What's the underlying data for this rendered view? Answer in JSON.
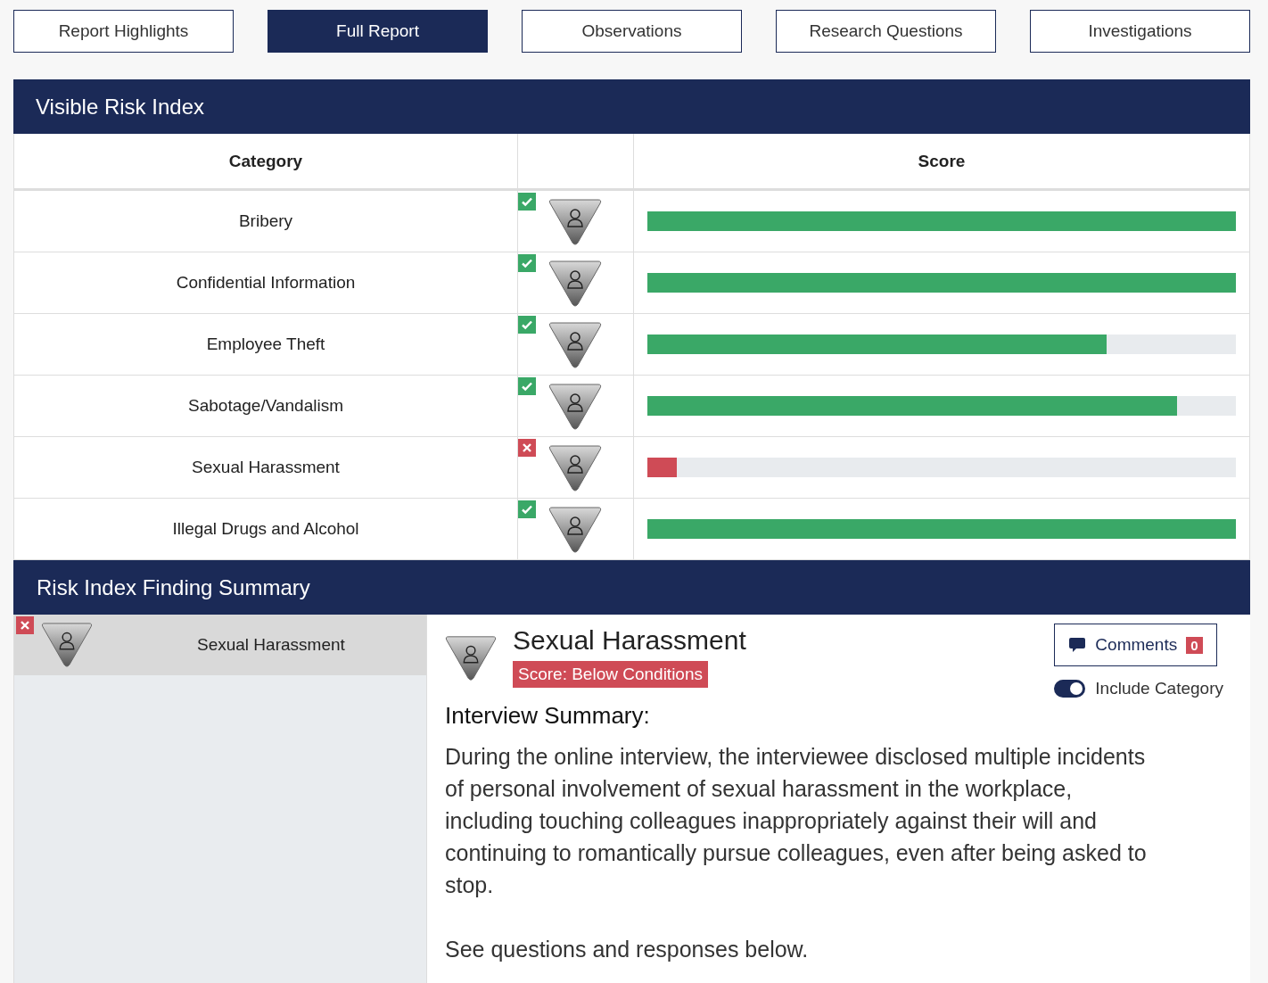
{
  "tabs": [
    {
      "label": "Report Highlights",
      "selected": false
    },
    {
      "label": "Full Report",
      "selected": true
    },
    {
      "label": "Observations",
      "selected": false
    },
    {
      "label": "Research Questions",
      "selected": false
    },
    {
      "label": "Investigations",
      "selected": false
    }
  ],
  "risk_index": {
    "title": "Visible Risk Index",
    "columns": [
      "Category",
      "Score"
    ],
    "rows": [
      {
        "category": "Bribery",
        "included": true,
        "level": 1
      },
      {
        "category": "Confidential Information",
        "included": true,
        "level": 1
      },
      {
        "category": "Employee Theft",
        "included": true,
        "level": 0.78
      },
      {
        "category": "Sabotage/Vandalism",
        "included": true,
        "level": 0.9
      },
      {
        "category": "Sexual Harassment",
        "included": false,
        "level": 0.05
      },
      {
        "category": "Illegal Drugs and Alcohol",
        "included": true,
        "level": 1
      }
    ]
  },
  "summary": {
    "title": "Risk Index Finding Summary",
    "items": [
      {
        "category": "Sexual Harassment",
        "included": false,
        "selected": true
      }
    ],
    "detail": {
      "title": "Sexual Harassment",
      "score_label": "Score: Below Conditions",
      "comments_label": "Comments",
      "comments_count": "0",
      "include_label": "Include Category",
      "include_on": true,
      "section_title": "Interview Summary:",
      "paragraphs": [
        "During the online interview, the interviewee disclosed multiple incidents of personal involvement of sexual harassment in the workplace, including touching colleagues inappropriately against their will and continuing to romantically pursue colleagues, even after being asked to stop.",
        "See questions and responses below."
      ]
    }
  }
}
